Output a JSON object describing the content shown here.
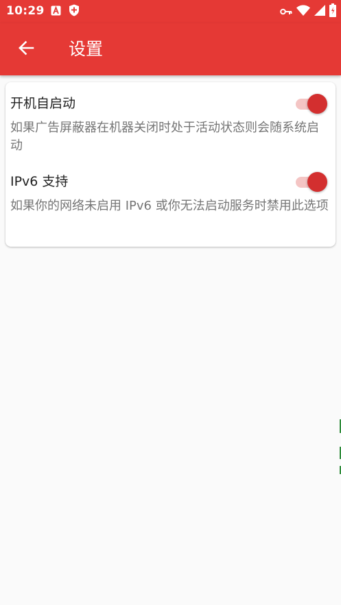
{
  "status_bar": {
    "time": "10:29",
    "color": "#e53935",
    "left_icons": [
      "text-a-icon",
      "shield-icon"
    ],
    "right_icons": [
      "key-icon",
      "wifi-icon",
      "signal-icon",
      "battery-icon"
    ]
  },
  "app_bar": {
    "title": "设置",
    "color": "#e53935"
  },
  "settings": [
    {
      "title": "开机自启动",
      "description": "如果广告屏蔽器在机器关闭时处于活动状态则会随系统启动",
      "enabled": true
    },
    {
      "title": "IPv6 支持",
      "description": "如果你的网络未启用 IPv6 或你无法启动服务时禁用此选项",
      "enabled": true
    }
  ],
  "colors": {
    "accent": "#d32f2f",
    "track_on": "#f4c5c4",
    "background": "#fafafa"
  }
}
